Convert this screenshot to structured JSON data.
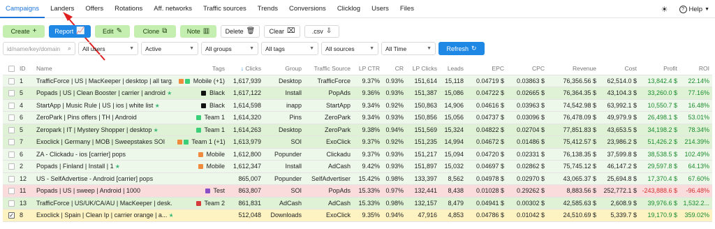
{
  "nav": {
    "items": [
      "Campaigns",
      "Landers",
      "Offers",
      "Rotations",
      "Aff. networks",
      "Traffic sources",
      "Trends",
      "Conversions",
      "Clicklog",
      "Users",
      "Files"
    ],
    "active": "Campaigns",
    "help_label": "Help"
  },
  "toolbar": {
    "create": "Create",
    "report": "Report",
    "edit": "Edit",
    "clone": "Clone",
    "note": "Note",
    "delete": "Delete",
    "clear": "Clear",
    "csv": ".csv"
  },
  "filters": {
    "search_placeholder": "id/name/key/domain",
    "users": "All users",
    "status": "Active",
    "groups": "All groups",
    "tags": "All tags",
    "sources": "All sources",
    "time": "All Time",
    "refresh": "Refresh"
  },
  "table": {
    "columns": [
      "ID",
      "Name",
      "Tags",
      "Clicks",
      "Group",
      "Traffic Source",
      "LP CTR",
      "CR",
      "LP Clicks",
      "Leads",
      "EPC",
      "CPC",
      "Revenue",
      "Cost",
      "Profit",
      "ROI"
    ],
    "sort_indicator": "↓",
    "rows": [
      {
        "id": "1",
        "name": "TrafficForce | US | MacKeeper | desktop | all targ...",
        "tag_colors": [
          "#f08a3c",
          "#3ccf7a"
        ],
        "tags": "Mobile (+1)",
        "clicks": "1,617,939",
        "group": "Desktop",
        "source": "TrafficForce",
        "lpctr": "9.37%",
        "cr": "0.93%",
        "lpclicks": "151,614",
        "leads": "15,118",
        "epc": "0.04719 $",
        "cpc": "0.03863 $",
        "revenue": "76,356.56 $",
        "cost": "62,514.0 $",
        "profit": "13,842.4 $",
        "roi": "22.14%",
        "star": false,
        "bg": "bg-light",
        "profit_sign": "pos",
        "checked": false
      },
      {
        "id": "5",
        "name": "Popads | US | Clean Booster | carrier | android",
        "tag_colors": [
          "#111111"
        ],
        "tags": "Black",
        "clicks": "1,617,122",
        "group": "Install",
        "source": "PopAds",
        "lpctr": "9.36%",
        "cr": "0.93%",
        "lpclicks": "151,387",
        "leads": "15,086",
        "epc": "0.04722 $",
        "cpc": "0.02665 $",
        "revenue": "76,364.35 $",
        "cost": "43,104.3 $",
        "profit": "33,260.0 $",
        "roi": "77.16%",
        "star": true,
        "bg": "bg-mid",
        "profit_sign": "pos",
        "checked": false
      },
      {
        "id": "4",
        "name": "StartApp | Music Rule | US | ios | white list",
        "tag_colors": [
          "#111111"
        ],
        "tags": "Black",
        "clicks": "1,614,598",
        "group": "inapp",
        "source": "StartApp",
        "lpctr": "9.34%",
        "cr": "0.92%",
        "lpclicks": "150,863",
        "leads": "14,906",
        "epc": "0.04616 $",
        "cpc": "0.03963 $",
        "revenue": "74,542.98 $",
        "cost": "63,992.1 $",
        "profit": "10,550.7 $",
        "roi": "16.48%",
        "star": true,
        "bg": "bg-light",
        "profit_sign": "pos",
        "checked": false
      },
      {
        "id": "6",
        "name": "ZeroPark | Pins offers | TH | Android",
        "tag_colors": [
          "#3ccf7a"
        ],
        "tags": "Team 1",
        "clicks": "1,614,320",
        "group": "Pins",
        "source": "ZeroPark",
        "lpctr": "9.34%",
        "cr": "0.93%",
        "lpclicks": "150,856",
        "leads": "15,056",
        "epc": "0.04737 $",
        "cpc": "0.03096 $",
        "revenue": "76,478.09 $",
        "cost": "49,979.9 $",
        "profit": "26,498.1 $",
        "roi": "53.01%",
        "star": false,
        "bg": "bg-light",
        "profit_sign": "pos",
        "checked": false
      },
      {
        "id": "5",
        "name": "Zeropark | IT | Mystery Shopper | desktop",
        "tag_colors": [
          "#3ccf7a"
        ],
        "tags": "Team 1",
        "clicks": "1,614,263",
        "group": "Desktop",
        "source": "ZeroPark",
        "lpctr": "9.38%",
        "cr": "0.94%",
        "lpclicks": "151,569",
        "leads": "15,324",
        "epc": "0.04822 $",
        "cpc": "0.02704 $",
        "revenue": "77,851.83 $",
        "cost": "43,653.5 $",
        "profit": "34,198.2 $",
        "roi": "78.34%",
        "star": true,
        "bg": "bg-mid",
        "profit_sign": "pos",
        "checked": false
      },
      {
        "id": "7",
        "name": "Exoclick | Germany | MOB | Sweepstakes SOI",
        "tag_colors": [
          "#f08a3c",
          "#3ccf7a"
        ],
        "tags": "Team 1 (+1)",
        "clicks": "1,613,979",
        "group": "SOI",
        "source": "ExoClick",
        "lpctr": "9.37%",
        "cr": "0.92%",
        "lpclicks": "151,235",
        "leads": "14,994",
        "epc": "0.04672 $",
        "cpc": "0.01486 $",
        "revenue": "75,412.57 $",
        "cost": "23,986.2 $",
        "profit": "51,426.2 $",
        "roi": "214.39%",
        "star": false,
        "bg": "bg-mid",
        "profit_sign": "pos",
        "checked": false
      },
      {
        "id": "6",
        "name": "ZA - Clickadu - ios [carrier] pops",
        "tag_colors": [
          "#f08a3c"
        ],
        "tags": "Mobile",
        "clicks": "1,612,800",
        "group": "Popunder",
        "source": "Clickadu",
        "lpctr": "9.37%",
        "cr": "0.93%",
        "lpclicks": "151,217",
        "leads": "15,094",
        "epc": "0.04720 $",
        "cpc": "0.02331 $",
        "revenue": "76,138.35 $",
        "cost": "37,599.8 $",
        "profit": "38,538.5 $",
        "roi": "102.49%",
        "star": false,
        "bg": "bg-light",
        "profit_sign": "pos",
        "checked": false
      },
      {
        "id": "2",
        "name": "Popads | Finland | Install | 1",
        "tag_colors": [
          "#f08a3c"
        ],
        "tags": "Mobile",
        "clicks": "1,612,347",
        "group": "Install",
        "source": "AdCash",
        "lpctr": "9.42%",
        "cr": "0.93%",
        "lpclicks": "151,897",
        "leads": "15,032",
        "epc": "0.04697 $",
        "cpc": "0.02862 $",
        "revenue": "75,745.12 $",
        "cost": "46,147.2 $",
        "profit": "29,597.8 $",
        "roi": "64.13%",
        "star": true,
        "bg": "bg-light",
        "profit_sign": "pos",
        "checked": false
      },
      {
        "id": "12",
        "name": "US - SelfAdvertise - Android [carrier] pops",
        "tag_colors": [],
        "tags": "",
        "clicks": "865,007",
        "group": "Popunder",
        "source": "SelfAdvertiser",
        "lpctr": "15.42%",
        "cr": "0.98%",
        "lpclicks": "133,397",
        "leads": "8,562",
        "epc": "0.04978 $",
        "cpc": "0.02970 $",
        "revenue": "43,065.37 $",
        "cost": "25,694.8 $",
        "profit": "17,370.4 $",
        "roi": "67.60%",
        "star": false,
        "bg": "bg-light",
        "profit_sign": "pos",
        "checked": false
      },
      {
        "id": "11",
        "name": "Popads | US | sweep | Android | 1000",
        "tag_colors": [
          "#8a4fc7"
        ],
        "tags": "Test",
        "clicks": "863,807",
        "group": "SOI",
        "source": "PopAds",
        "lpctr": "15.33%",
        "cr": "0.97%",
        "lpclicks": "132,441",
        "leads": "8,438",
        "epc": "0.01028 $",
        "cpc": "0.29262 $",
        "revenue": "8,883.56 $",
        "cost": "252,772.1 $",
        "profit": "-243,888.6 $",
        "roi": "-96.48%",
        "star": false,
        "bg": "bg-red",
        "profit_sign": "neg",
        "checked": false
      },
      {
        "id": "13",
        "name": "TrafficForce | US/UK/CA/AU | MacKeeper | desk...",
        "tag_colors": [
          "#d63a3a"
        ],
        "tags": "Team 2",
        "clicks": "861,831",
        "group": "AdCash",
        "source": "AdCash",
        "lpctr": "15.33%",
        "cr": "0.98%",
        "lpclicks": "132,157",
        "leads": "8,479",
        "epc": "0.04941 $",
        "cpc": "0.00302 $",
        "revenue": "42,585.63 $",
        "cost": "2,608.9 $",
        "profit": "39,976.6 $",
        "roi": "1,532.2...",
        "star": false,
        "bg": "bg-mid",
        "profit_sign": "pos",
        "checked": false
      },
      {
        "id": "8",
        "name": "Exoclick | Spain | Clean Ip | carrier orange | a...",
        "tag_colors": [],
        "tags": "",
        "clicks": "512,048",
        "group": "Downloads",
        "source": "ExoClick",
        "lpctr": "9.35%",
        "cr": "0.94%",
        "lpclicks": "47,916",
        "leads": "4,853",
        "epc": "0.04786 $",
        "cpc": "0.01042 $",
        "revenue": "24,510.69 $",
        "cost": "5,339.7 $",
        "profit": "19,170.9 $",
        "roi": "359.02%",
        "star": true,
        "bg": "bg-yellow",
        "profit_sign": "pos",
        "checked": true
      }
    ]
  },
  "colors": {
    "accent": "#1f88e5",
    "green_button": "#c5efb0",
    "positive": "#1a8a2e",
    "negative": "#d32f2f"
  }
}
